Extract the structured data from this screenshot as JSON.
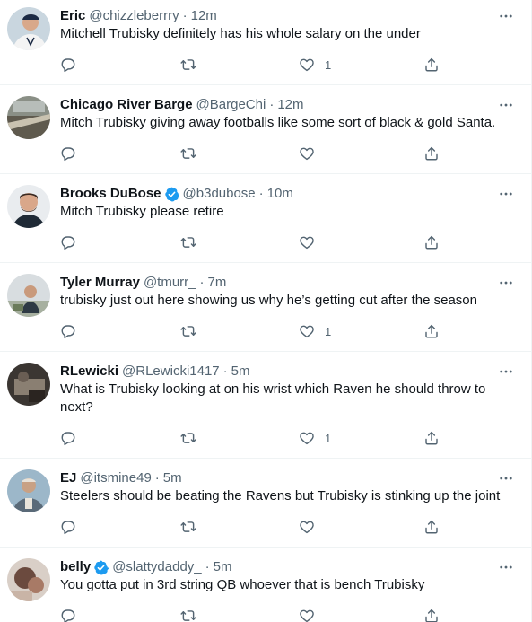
{
  "tweets": [
    {
      "name": "Eric",
      "handle": "@chizzleberrry",
      "time": "12m",
      "verified": false,
      "text": "Mitchell Trubisky definitely has his whole salary on the under",
      "likes": "1"
    },
    {
      "name": "Chicago River Barge",
      "handle": "@BargeChi",
      "time": "12m",
      "verified": false,
      "text": "Mitch Trubisky giving away footballs like some sort of black & gold Santa.",
      "likes": ""
    },
    {
      "name": "Brooks DuBose",
      "handle": "@b3dubose",
      "time": "10m",
      "verified": true,
      "text": "Mitch Trubisky please retire",
      "likes": ""
    },
    {
      "name": "Tyler Murray",
      "handle": "@tmurr_",
      "time": "7m",
      "verified": false,
      "text": "trubisky just out here showing us why he’s getting cut after the season",
      "likes": "1"
    },
    {
      "name": "RLewicki",
      "handle": "@RLewicki1417",
      "time": "5m",
      "verified": false,
      "text": "What is Trubisky looking at on his wrist which Raven he should throw to next?",
      "likes": "1"
    },
    {
      "name": "EJ",
      "handle": "@itsmine49",
      "time": "5m",
      "verified": false,
      "text": "Steelers should be beating the Ravens but Trubisky is stinking up the joint",
      "likes": ""
    },
    {
      "name": "belly",
      "handle": "@slattydaddy_",
      "time": "5m",
      "verified": true,
      "text": "You gotta put in 3rd string QB whoever that is bench Trubisky",
      "likes": ""
    }
  ],
  "separator": "·",
  "icons": {
    "reply": "reply-icon",
    "retweet": "retweet-icon",
    "like": "like-icon",
    "share": "share-icon",
    "more": "more-icon",
    "verified": "verified-badge-icon"
  },
  "colors": {
    "text": "#0f1419",
    "secondary": "#536471",
    "verified": "#1d9bf0",
    "divider": "#eff3f4"
  }
}
